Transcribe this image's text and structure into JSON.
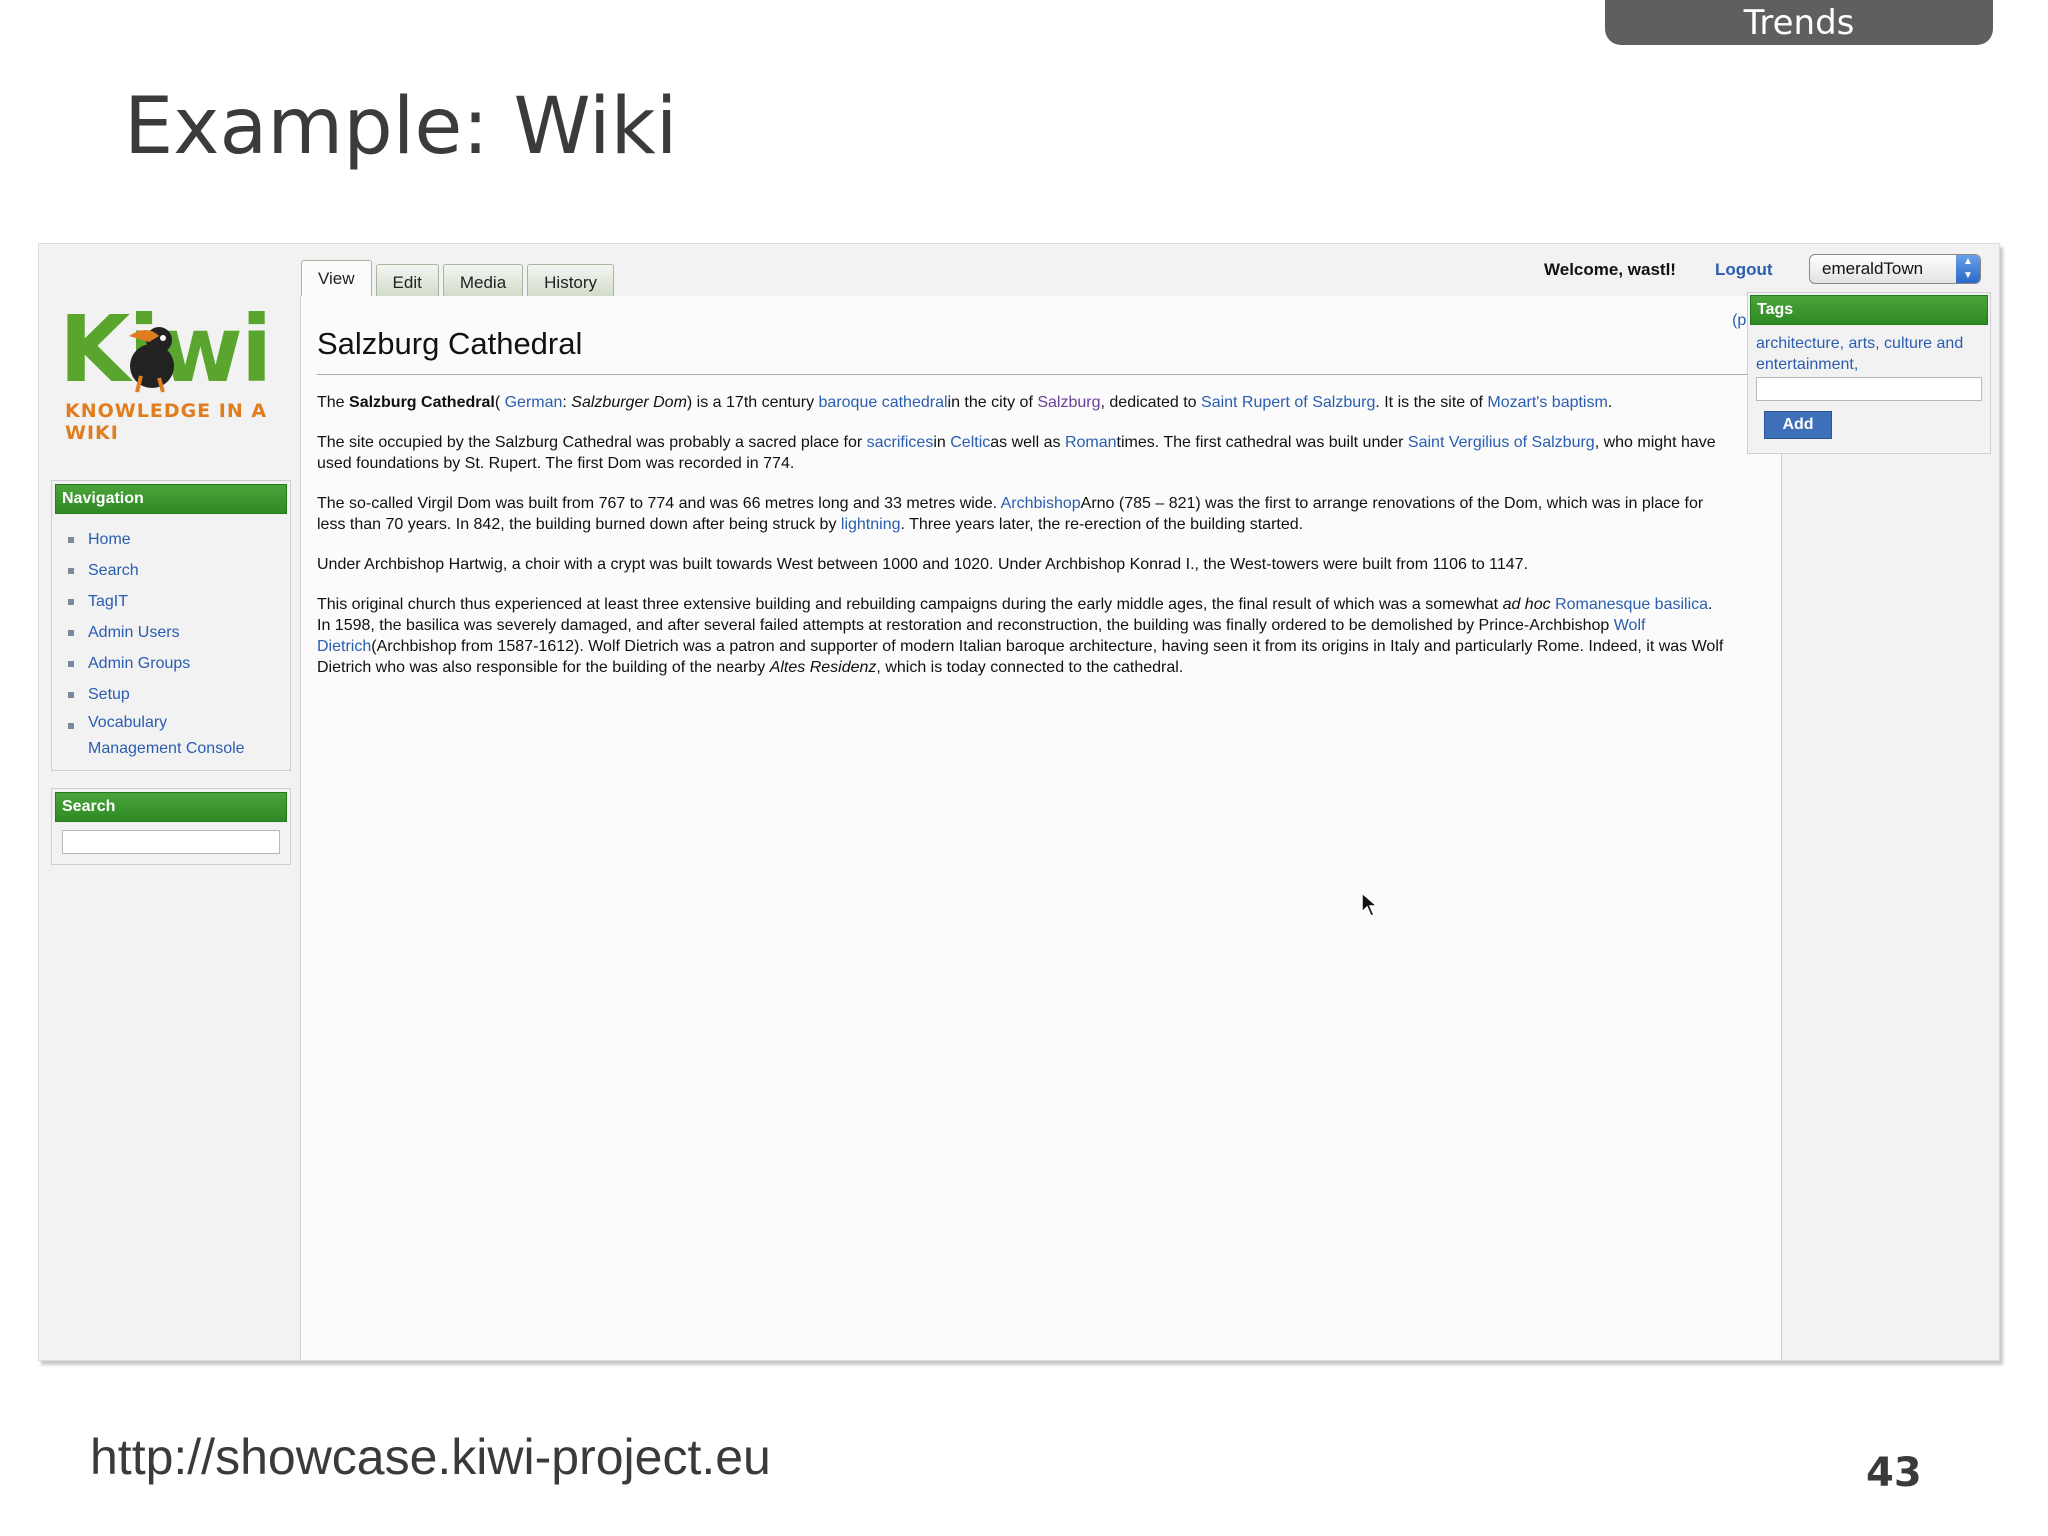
{
  "slide": {
    "section_tab": "Trends",
    "title": "Example: Wiki",
    "url": "http://showcase.kiwi-project.eu",
    "page_number": "43"
  },
  "colors": {
    "accent_green": "#2f8a25",
    "link_blue": "#2a5db0",
    "logo_green": "#5aa52d",
    "logo_orange": "#e07d1f"
  },
  "wiki": {
    "logo": {
      "word": "Kiwi",
      "tagline": "KNOWLEDGE IN A WIKI"
    },
    "tabs": [
      "View",
      "Edit",
      "Media",
      "History"
    ],
    "header": {
      "welcome": "Welcome, wastl!",
      "logout": "Logout",
      "space_select": "emeraldTown"
    },
    "navigation": {
      "title": "Navigation",
      "items": [
        "Home",
        "Search",
        "TagIT",
        "Admin Users",
        "Admin Groups",
        "Setup",
        "Vocabulary Management Console"
      ]
    },
    "search_panel": {
      "title": "Search"
    },
    "pdf_link": "(pdf)",
    "article": {
      "title": "Salzburg Cathedral",
      "p1": {
        "a": "The ",
        "b": "Salzburg Cathedral",
        "c": "( ",
        "d": "German",
        "e": ": ",
        "f": "Salzburger Dom",
        "g": ") is a 17th century ",
        "h": "baroque cathedral",
        "i": "in the city of ",
        "j": "Salzburg",
        "k": ", dedicated to ",
        "l": "Saint Rupert of Salzburg",
        "m": ". It is the site of ",
        "n": "Mozart's baptism",
        "o": "."
      },
      "p2": {
        "a": "The site occupied by the Salzburg Cathedral was probably a sacred place for ",
        "b": "sacrifices",
        "c": "in ",
        "d": "Celtic",
        "e": "as well as ",
        "f": "Roman",
        "g": "times. The first cathedral was built under ",
        "h": "Saint Vergilius of Salzburg",
        "i": ", who might have used foundations by St. Rupert. The first Dom was recorded in 774."
      },
      "p3": {
        "a": "The so-called Virgil Dom was built from 767 to 774 and was 66 metres long and 33 metres wide. ",
        "b": "Archbishop",
        "c": "Arno (785 – 821) was the first to arrange renovations of the Dom, which was in place for less than 70 years. In 842, the building burned down after being struck by ",
        "d": "lightning",
        "e": ". Three years later, the re-erection of the building started."
      },
      "p4": "Under Archbishop Hartwig, a choir with a crypt was built towards West between 1000 and 1020. Under Archbishop Konrad I., the West-towers were built from 1106 to 1147.",
      "p5": {
        "a": "This original church thus experienced at least three extensive building and rebuilding campaigns during the early middle ages, the final result of which was a somewhat ",
        "b": "ad hoc",
        "c": " ",
        "d": "Romanesque basilica",
        "e": ". In 1598, the basilica was severely damaged, and after several failed attempts at restoration and reconstruction, the building was finally ordered to be demolished by Prince-Archbishop ",
        "f": "Wolf Dietrich",
        "g": "(Archbishop from 1587-1612). Wolf Dietrich was a patron and supporter of modern Italian baroque architecture, having seen it from its origins in Italy and particularly Rome. Indeed, it was Wolf Dietrich who was also responsible for the building of the nearby ",
        "h": "Altes Residenz",
        "i": ", which is today connected to the cathedral."
      }
    },
    "tags_panel": {
      "title": "Tags",
      "tags": "architecture, arts, culture and entertainment,",
      "add_label": "Add"
    }
  }
}
